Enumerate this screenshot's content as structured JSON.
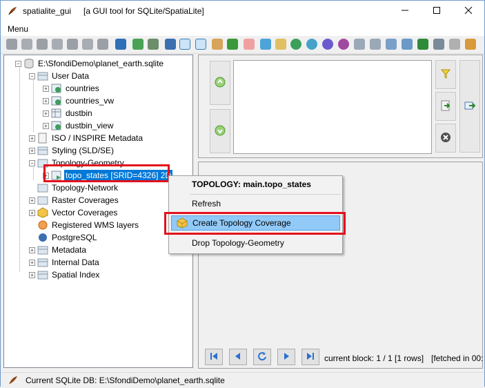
{
  "window": {
    "app_name": "spatialite_gui",
    "description": "[a GUI tool for SQLite/SpatiaLite]",
    "minimize_icon": "minimize-icon",
    "maximize_icon": "maximize-icon",
    "close_icon": "close-icon"
  },
  "menu": {
    "label": "Menu"
  },
  "tree": {
    "root": "E:\\SfondiDemo\\planet_earth.sqlite",
    "user_data": "User Data",
    "items": {
      "countries": "countries",
      "countries_vw": "countries_vw",
      "dustbin": "dustbin",
      "dustbin_view": "dustbin_view"
    },
    "iso": "ISO / INSPIRE Metadata",
    "styling": "Styling (SLD/SE)",
    "topology_geometry": "Topology-Geometry",
    "topo_states": "topo_states [SRID=4326] 2D",
    "topology_network": "Topology-Network",
    "raster": "Raster Coverages",
    "vector": "Vector Coverages",
    "wms": "Registered WMS layers",
    "postgresql": "PostgreSQL",
    "metadata": "Metadata",
    "internal": "Internal Data",
    "spatial_index": "Spatial Index"
  },
  "context_menu": {
    "title": "TOPOLOGY: main.topo_states",
    "refresh": "Refresh",
    "create": "Create Topology Coverage",
    "drop": "Drop Topology-Geometry"
  },
  "results": {
    "block": "current block: 1 / 1 [1 rows]",
    "fetched": "[fetched in 00:"
  },
  "status": {
    "text": "Current SQLite DB: E:\\SfondiDemo\\planet_earth.sqlite"
  },
  "colors": {
    "highlight": "#e3101c",
    "selection": "#0078d7",
    "menu_hover": "#91c9f7"
  }
}
